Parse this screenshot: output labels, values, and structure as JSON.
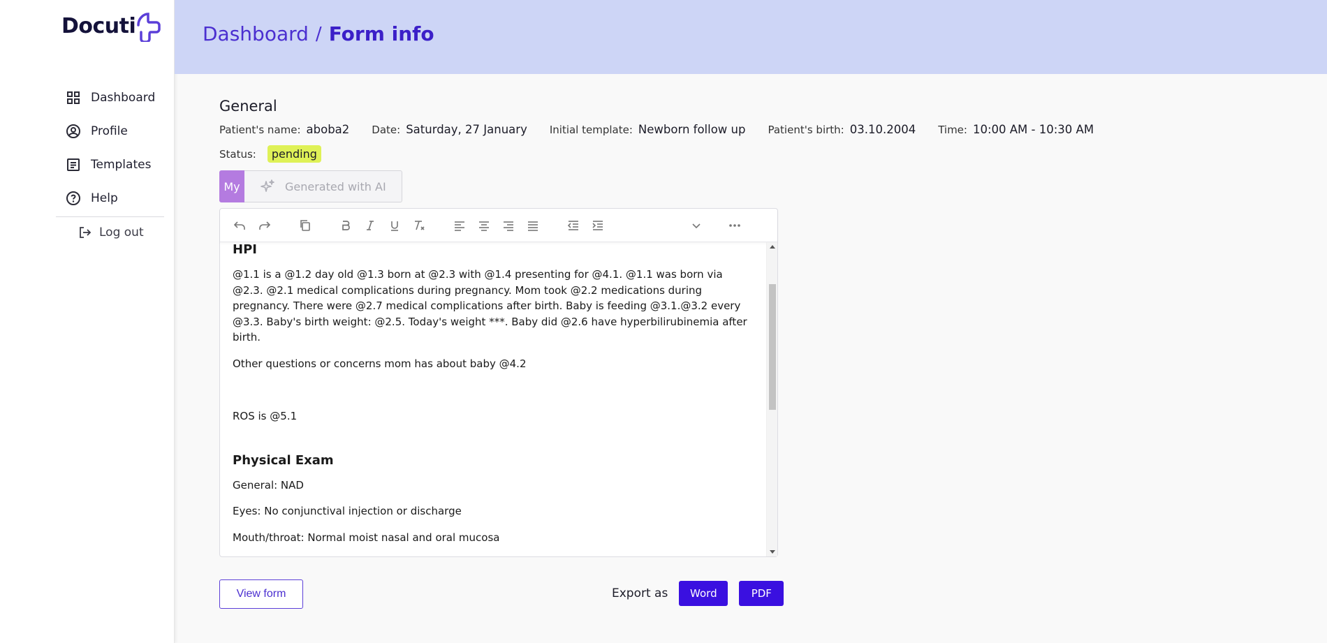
{
  "sidebar": {
    "logo_text": "Docuti",
    "items": [
      {
        "label": "Dashboard",
        "icon": "grid-icon"
      },
      {
        "label": "Profile",
        "icon": "user-circle-icon"
      },
      {
        "label": "Templates",
        "icon": "document-icon"
      },
      {
        "label": "Help",
        "icon": "help-circle-icon"
      }
    ],
    "logout_label": "Log out"
  },
  "header": {
    "breadcrumb_root": "Dashboard",
    "breadcrumb_separator": "/",
    "breadcrumb_current": "Form info"
  },
  "general": {
    "title": "General",
    "patient_name_label": "Patient's name:",
    "patient_name": "aboba2",
    "date_label": "Date:",
    "date": "Saturday, 27 January",
    "template_label": "Initial template:",
    "template": "Newborn follow up",
    "birth_label": "Patient's birth:",
    "birth": "03.10.2004",
    "time_label": "Time:",
    "time": "10:00 AM - 10:30 AM",
    "status_label": "Status:",
    "status": "pending"
  },
  "tabs": {
    "my": "My",
    "ai": "Generated with AI"
  },
  "editor": {
    "hpi_heading": "HPI",
    "hpi_text": "@1.1 is a @1.2 day old @1.3 born at @2.3 with @1.4 presenting for @4.1. @1.1 was born via @2.3. @2.1 medical complications during pregnancy. Mom took @2.2 medications during pregnancy. There were @2.7 medical complications after birth. Baby is feeding @3.1.@3.2 every @3.3. Baby's birth weight: @2.5. Today's weight ***. Baby did @2.6 have hyperbilirubinemia after birth.",
    "other_questions": "Other questions or concerns mom has about baby @4.2",
    "ros": "ROS is @5.1",
    "pe_heading": "Physical Exam",
    "pe_general": "General: NAD",
    "pe_eyes": "Eyes: No conjunctival injection or discharge",
    "pe_mouth": "Mouth/throat: Normal moist nasal and oral mucosa"
  },
  "actions": {
    "view_form": "View form",
    "export_label": "Export as",
    "word": "Word",
    "pdf": "PDF"
  },
  "colors": {
    "primary": "#3a10e0",
    "header_bg": "#cdd5f6",
    "status_badge": "#dff157",
    "tab_my": "#b47be0"
  }
}
